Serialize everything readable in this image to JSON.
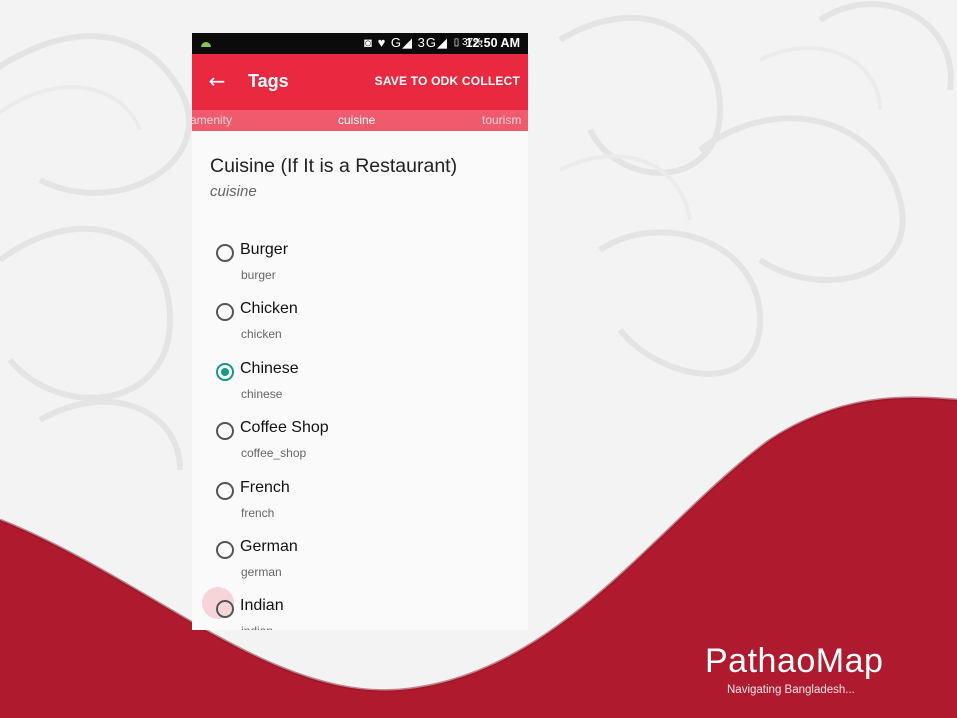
{
  "status_bar": {
    "icons": "◙ ♥ G◢ 3G◢",
    "battery": "▯ 37%",
    "time": "12:50 AM"
  },
  "toolbar": {
    "title": "Tags",
    "back_icon": "←",
    "action_label": "SAVE TO ODK COLLECT"
  },
  "tabs": [
    {
      "label": "amenity",
      "selected": false
    },
    {
      "label": "cuisine",
      "selected": true
    },
    {
      "label": "tourism",
      "selected": false
    }
  ],
  "question": {
    "title": "Cuisine (If It is a Restaurant)",
    "key": "cuisine"
  },
  "options": [
    {
      "label": "Burger",
      "key": "burger",
      "checked": false
    },
    {
      "label": "Chicken",
      "key": "chicken",
      "checked": false
    },
    {
      "label": "Chinese",
      "key": "chinese",
      "checked": true
    },
    {
      "label": "Coffee Shop",
      "key": "coffee_shop",
      "checked": false
    },
    {
      "label": "French",
      "key": "french",
      "checked": false
    },
    {
      "label": "German",
      "key": "german",
      "checked": false
    },
    {
      "label": "Indian",
      "key": "indian",
      "checked": false
    }
  ],
  "branding": {
    "name": "PathaoMap",
    "tagline": "Navigating Bangladesh...",
    "red": "#b01a2e",
    "accent": "#e8293f",
    "radio_checked": "#16978a"
  }
}
